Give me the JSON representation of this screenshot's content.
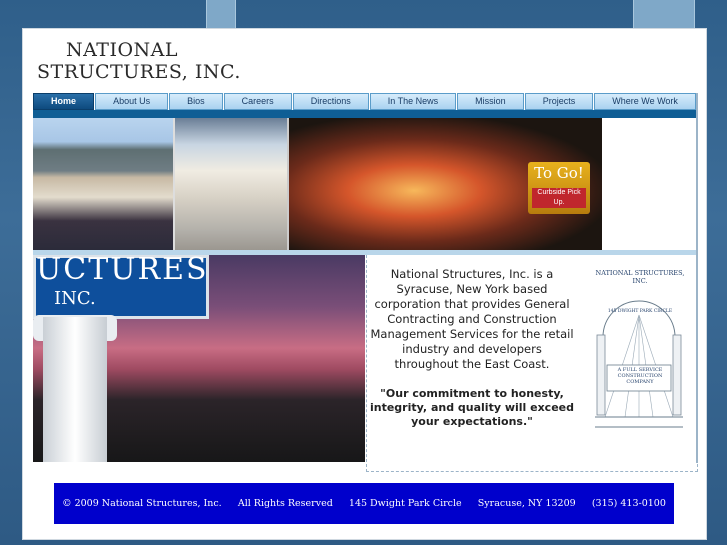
{
  "logo": {
    "line1": "NATIONAL",
    "line2": "STRUCTURES, INC."
  },
  "nav": {
    "items": [
      "Home",
      "About Us",
      "Bios",
      "Careers",
      "Directions",
      "In The News",
      "Mission",
      "Projects",
      "Where We Work"
    ],
    "active": "Home"
  },
  "photos": {
    "storefront_sign": "To Go!",
    "curbside": "Curbside Pick Up."
  },
  "sunset_sign": {
    "line1": "UCTURES",
    "line2": "INC."
  },
  "intro": {
    "description": "National Structures, Inc. is a Syracuse, New York based corporation that provides General Contracting and Construction Management Services for the retail industry and developers throughout the East Coast.",
    "motto": "\"Our commitment to honesty, integrity, and quality will exceed your expectations.\""
  },
  "seal": {
    "top_text": "NATIONAL STRUCTURES, INC.",
    "address": "145 DWIGHT PARK CIRCLE",
    "bottom_text": "A FULL SERVICE CONSTRUCTION COMPANY"
  },
  "footer": {
    "copyright": "© 2009 National Structures, Inc.",
    "rights": "All Rights Reserved",
    "street": "145 Dwight Park Circle",
    "city": "Syracuse, NY 13209",
    "phone": "(315) 413-0100"
  },
  "colors": {
    "nav_active": "#0e4a7e",
    "nav_item": "#a9d2f0",
    "footer_bg": "#0000cc",
    "page_bg": "#2f5f8a"
  }
}
